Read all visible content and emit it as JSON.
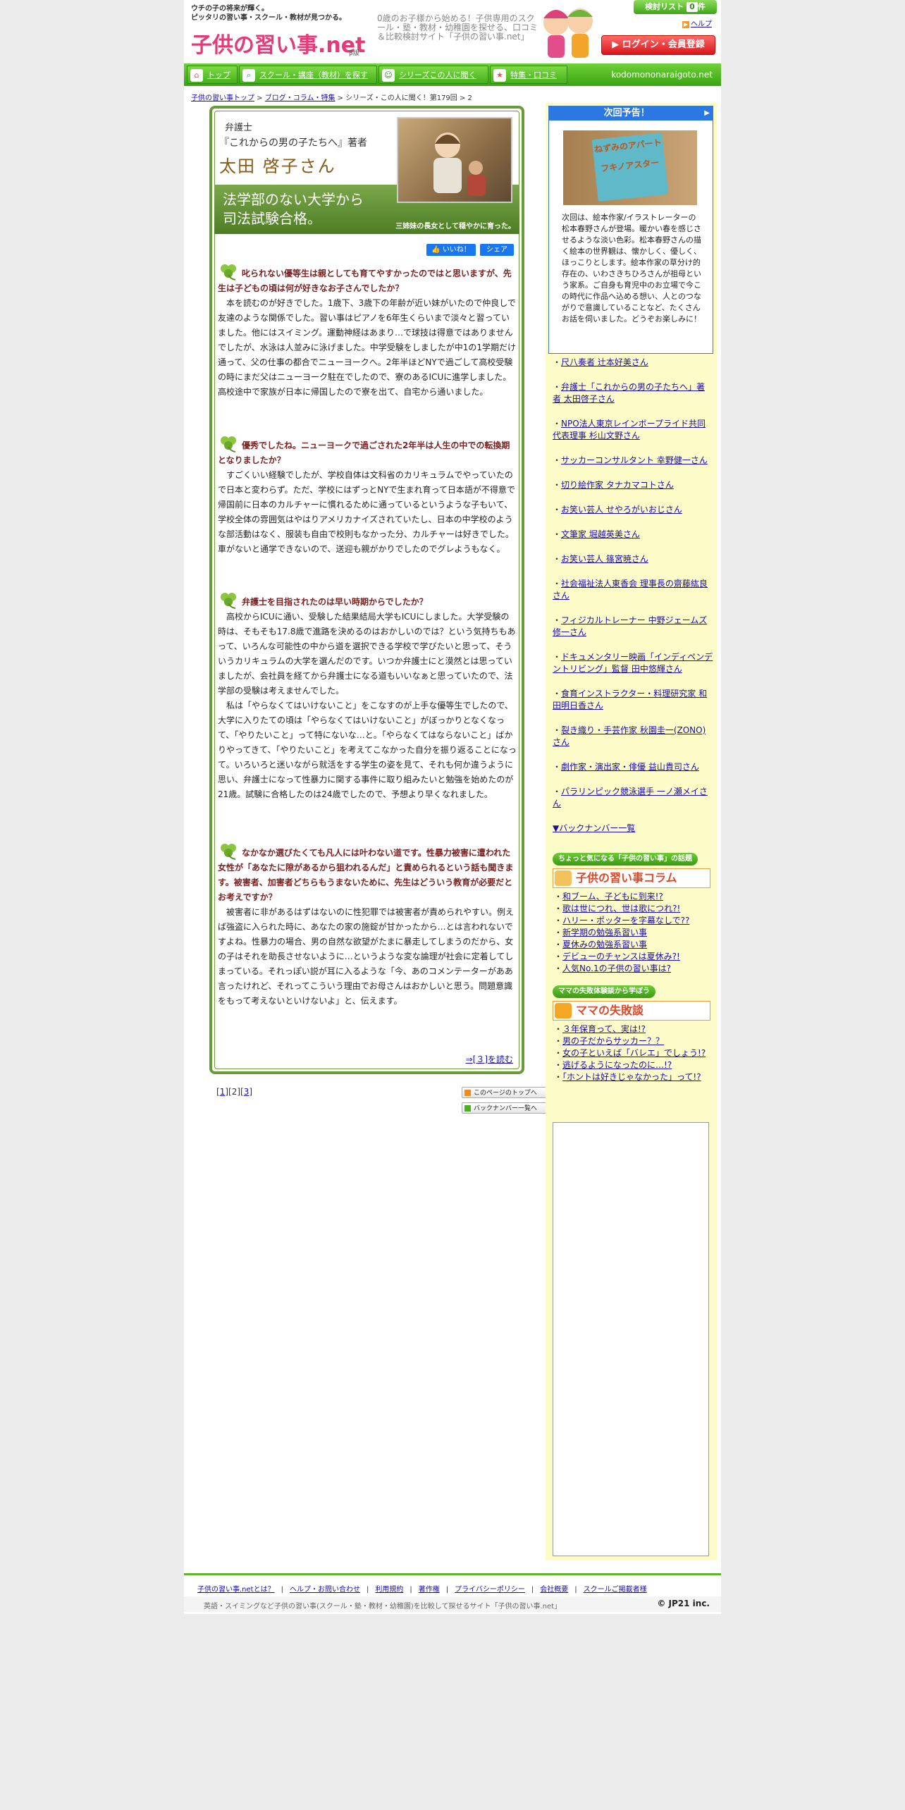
{
  "header": {
    "tagline1": "ウチの子の将来が輝く。",
    "tagline2": "ピッタリの習い事・スクール・教材が見つかる。",
    "logo_text": "子供の習い事.net",
    "logo_suffix": "β版",
    "description": "0歳のお子様から始める！子供専用のスクール・塾・教材・幼稚園を探せる、口コミ＆比較検討サイト「子供の習い事.net」",
    "kentou_label": "検討リスト",
    "kentou_count": "0",
    "kentou_unit": "件",
    "help_label": "ヘルプ",
    "login_label": "ログイン・会員登録"
  },
  "nav": {
    "items": [
      {
        "label": "トップ",
        "icon": "home-icon"
      },
      {
        "label": "スクール・講座（教材）を探す",
        "icon": "search-icon"
      },
      {
        "label": "シリーズこの人に聞く",
        "icon": "person-icon"
      },
      {
        "label": "特集・口コミ",
        "icon": "star-icon"
      }
    ],
    "domain": "kodomononaraigoto.net"
  },
  "breadcrumb": {
    "items": [
      "子供の習い事トップ",
      "ブログ・コラム・特集"
    ],
    "current": "シリーズ・この人に聞く！第179回 > 2"
  },
  "article": {
    "role": "弁護士",
    "book": "『これからの男の子たちへ』著者",
    "author": "太田 啓子さん",
    "heading1": "法学部のない大学から",
    "heading2": "司法試験合格。",
    "photo_caption": "三姉妹の長女として穏やかに育った。",
    "like_label": "いいね！",
    "share_label": "シェア",
    "qa": [
      {
        "q": "叱られない優等生は親としても育てやすかったのではと思いますが、先生は子どもの頃は何が好きなお子さんでしたか？",
        "a": [
          "本を読むのが好きでした。1歳下、3歳下の年齢が近い妹がいたので仲良しで友達のような関係でした。習い事はピアノを6年生くらいまで淡々と習っていました。他にはスイミング。運動神経はあまり…で球技は得意ではありませんでしたが、水泳は人並みに泳げました。中学受験をしましたが中1の1学期だけ通って、父の仕事の都合でニューヨークへ。2年半ほどNYで過ごして高校受験の時にまだ父はニューヨーク駐在でしたので、寮のあるICUに進学しました。高校途中で家族が日本に帰国したので寮を出て、自宅から通いました。"
        ]
      },
      {
        "q": "優秀でしたね。ニューヨークで過ごされた2年半は人生の中での転換期となりましたか？",
        "a": [
          "すごくいい経験でしたが、学校自体は文科省のカリキュラムでやっていたので日本と変わらず。ただ、学校にはずっとNYで生まれ育って日本語が不得意で帰国前に日本のカルチャーに慣れるために通っているというような子もいて、学校全体の雰囲気はやはりアメリカナイズされていたし、日本の中学校のような部活動はなく、服装も自由で校則もなかった分、カルチャーは好きでした。車がないと通学できないので、送迎も親がかりでしたのでグレようもなく。"
        ]
      },
      {
        "q": "弁護士を目指されたのは早い時期からでしたか？",
        "a": [
          "高校からICUに通い、受験した結果結局大学もICUにしました。大学受験の時は、そもそも17.8歳で進路を決めるのはおかしいのでは？という気持ちもあって、いろんな可能性の中から道を選択できる学校で学びたいと思って、そういうカリキュラムの大学を選んだのです。いつか弁護士にと漠然とは思っていましたが、会社員を経てから弁護士になる道もいいなぁと思っていたので、法学部の受験は考えませんでした。",
          "私は「やらなくてはいけないこと」をこなすのが上手な優等生でしたので、大学に入りたての頃は「やらなくてはいけないこと」がぼっかりとなくなって、「やりたいこと」って特にないな…と。「やらなくてはならないこと」ばかりやってきて、「やりたいこと」を考えてこなかった自分を振り返ることになって。いろいろと迷いながら就活をする学生の姿を見て、それも何か違うように思い、弁護士になって性暴力に関する事件に取り組みたいと勉強を始めたのが21歳。試験に合格したのは24歳でしたので、予想より早くなれました。"
        ]
      },
      {
        "q": "なかなか選びたくても凡人には叶わない道です。性暴力被害に遭われた女性が「あなたに隙があるから狙われるんだ」と責められるという話も聞きます。被害者、加害者どちらもうまないために、先生はどういう教育が必要だとお考えですか？",
        "a": [
          "被害者に非があるはずはないのに性犯罪では被害者が責められやすい。例えば強盗に入られた時に、あなたの家の施錠が甘かったから…とは言われないですよね。性暴力の場合、男の自然な欲望がたまに暴走してしまうのだから、女の子はそれを助長させないように…というような変な論理が社会に定着してしまっている。それっぽい説が耳に入るような「今、あのコメンテーターがああ言ったけれど、それってこういう理由でお母さんはおかしいと思う。問題意識をもって考えないといけないよ」と、伝えます。"
        ]
      }
    ],
    "readmore": "⇒[３]を読む"
  },
  "pager": {
    "prefix1": "[",
    "p1": "1",
    "mid1": "][",
    "current": "2",
    "mid2": "][",
    "p3": "3",
    "suffix": "]",
    "top_label": "このページのトップへ",
    "backnumber_label": "バックナンバー一覧へ"
  },
  "sidebar": {
    "notice_title": "次回予告！",
    "notice_book_text": "ねずみのアパートフキノアスター",
    "notice_text": "次回は、絵本作家/イラストレーターの松本春野さんが登場。暖かい春を感じさせるような淡い色彩。松本春野さんの描く絵本の世界観は、懐かしく、優しく、ほっこりとします。絵本作家の草分け的存在の、いわさきちひろさんが祖母という家系。ご自身も育児中のお立場で今この時代に作品へ込める想い、人とのつながりで意識していることなど、たくさんお話を伺いました。どうぞお楽しみに！",
    "series": [
      "尺八奏者 辻本好美さん",
      "弁護士「これからの男の子たちへ」著者 太田啓子さん",
      "NPO法人東京レインボープライド共同代表理事 杉山文野さん",
      "サッカーコンサルタント 幸野健一さん",
      "切り絵作家 タナカマコトさん",
      "お笑い芸人 せやろがいおじさん",
      "文筆家 堀越英美さん",
      "お笑い芸人 篠宮暁さん",
      "社会福祉法人東香会 理事長の齋藤紘良さん",
      "フィジカルトレーナー 中野ジェームズ修一さん",
      "ドキュメンタリー映画「インディペンデントリビング」監督 田中悠輝さん",
      "食育インストラクター・料理研究家 和田明日香さん",
      "裂き織り・手芸作家 秋園圭一(ZONO)さん",
      "劇作家・演出家・俳優 益山貴司さん",
      "パラリンピック競泳選手 一ノ瀬メイさん"
    ],
    "backnumber": "▼バックナンバー一覧",
    "column_tag": "ちょっと気になる「子供の習い事」の話題",
    "column_head": "子供の習い事コラム",
    "column_items": [
      "和ブーム、子どもに到来!?",
      "歌は世につれ、世は歌につれ?!",
      "ハリー・ポッターを字幕なしで??",
      "新学期の勉強系習い事",
      "夏休みの勉強系習い事",
      "デビューのチャンスは夏休み?!",
      "人気No.1の子供の習い事は?"
    ],
    "failure_tag": "ママの失敗体験談から学ぼう",
    "failure_head": "ママの失敗談",
    "failure_items": [
      "３年保育って、実は!?",
      "男の子だからサッカー？？",
      "女の子といえば「バレエ」でしょう!?",
      "逃げるようになったのに…!?",
      "「ホントは好きじゃなかった」って!?"
    ]
  },
  "footer": {
    "links": [
      "子供の習い事.netとは？",
      "ヘルプ・お問い合わせ",
      "利用規約",
      "著作権",
      "プライバシーポリシー",
      "会社概要",
      "スクールご掲載者様"
    ],
    "description": "英語・スイミングなど子供の習い事(スクール・塾・教材・幼稚園)を比較して探せるサイト「子供の習い事.net」",
    "copyright": "© JP21 inc."
  },
  "colors": {
    "brand_green": "#4cb020",
    "heading_green": "#5e8e30",
    "question_red": "#7a2222",
    "login_red": "#d7161a",
    "sidebar_bg": "#fdfbc8",
    "link": "#1a0dab"
  }
}
